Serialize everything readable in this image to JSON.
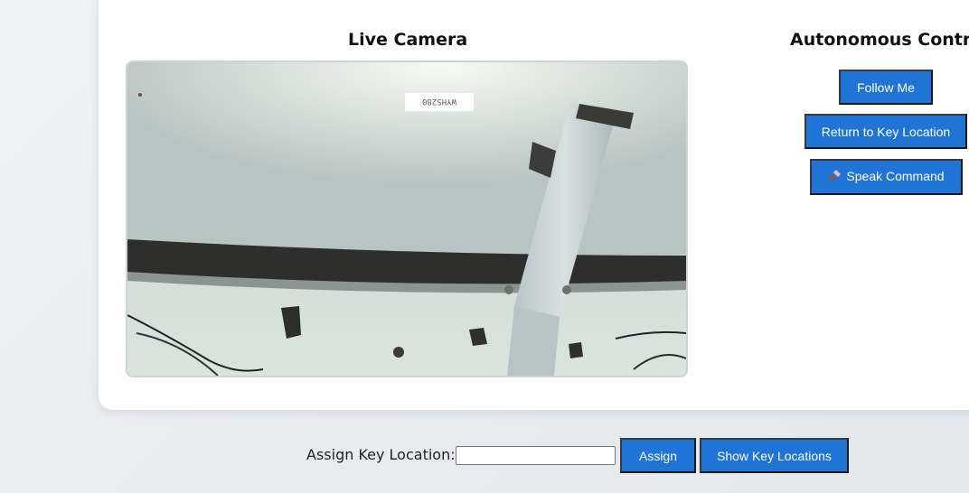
{
  "camera": {
    "title": "Live Camera",
    "feed_label": "WYHS280"
  },
  "autonomous": {
    "title": "Autonomous Control",
    "follow_label": "Follow Me",
    "return_label": "Return to Key Location",
    "speak_label": "Speak Command",
    "speak_icon": "microphone-icon"
  },
  "assign": {
    "label": "Assign Key Location:",
    "input_value": "",
    "input_placeholder": "",
    "assign_label": "Assign",
    "show_label": "Show Key Locations"
  },
  "colors": {
    "button_bg": "#1f74d6",
    "button_text": "#ffffff",
    "card_bg": "#ffffff",
    "page_bg": "#e9ecf2"
  }
}
